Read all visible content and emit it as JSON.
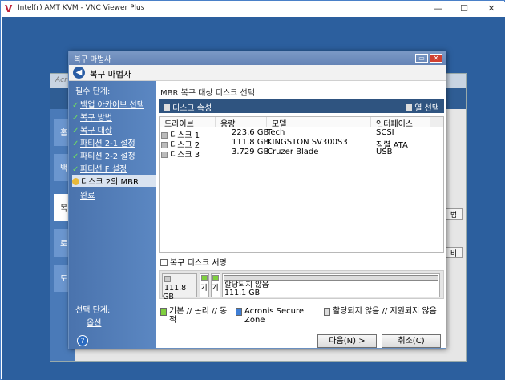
{
  "window": {
    "title": "Intel(r) AMT KVM - VNC Viewer Plus",
    "minimize": "—",
    "maximize": "☐",
    "close": "✕"
  },
  "bg_app": {
    "title": "Acr",
    "tabs": [
      "홈",
      "백",
      "복",
      "로",
      "도"
    ],
    "right_labels": [
      "법",
      "비"
    ]
  },
  "dialog": {
    "title": "복구 마법사",
    "header_title": "복구 마법사",
    "sidebar": {
      "required_heading": "필수 단계:",
      "steps": [
        {
          "label": "백업 아카이브 선택",
          "done": true
        },
        {
          "label": "복구 방법",
          "done": true
        },
        {
          "label": "복구 대상",
          "done": true
        },
        {
          "label": "파티션 2-1 설정",
          "done": true
        },
        {
          "label": "파티션 2-2 설정",
          "done": true
        },
        {
          "label": "파티션 F 설정",
          "done": true
        },
        {
          "label": "디스크 2의 MBR",
          "current": true
        },
        {
          "label": "완료"
        }
      ],
      "optional_heading": "선택 단계:",
      "options": "옵션"
    },
    "main": {
      "title": "MBR 복구 대상 디스크 선택",
      "toolbar": {
        "properties": "디스크 속성",
        "columns": "열 선택"
      },
      "columns": [
        "드라이브",
        "용량",
        "모델",
        "인터페이스"
      ],
      "rows": [
        {
          "drive": "디스크 1",
          "capacity": "223.6 GB",
          "model": "Tech",
          "interface": "SCSI"
        },
        {
          "drive": "디스크 2",
          "capacity": "111.8 GB",
          "model": "KINGSTON SV300S3",
          "interface": "직렬 ATA"
        },
        {
          "drive": "디스크 3",
          "capacity": "3.729 GB",
          "model": "Cruzer Blade",
          "interface": "USB"
        }
      ],
      "signature_checkbox": "복구 디스크 서명",
      "diskmap": {
        "disk_size": "111.8 GB",
        "p1": "기",
        "p2": "기",
        "unalloc_label": "할당되지 않음",
        "unalloc_size": "111.1 GB"
      },
      "legend": {
        "basic": "기본 // 논리 // 동적",
        "acronis": "Acronis Secure Zone",
        "unallocated": "할당되지 않음 // 지원되지 않음"
      },
      "next": "다음(N) >",
      "cancel": "취소(C)"
    }
  },
  "colors": {
    "accent": "#2f5480",
    "sidebar": "#4a73ad",
    "desktop": "#2c5f9e"
  }
}
